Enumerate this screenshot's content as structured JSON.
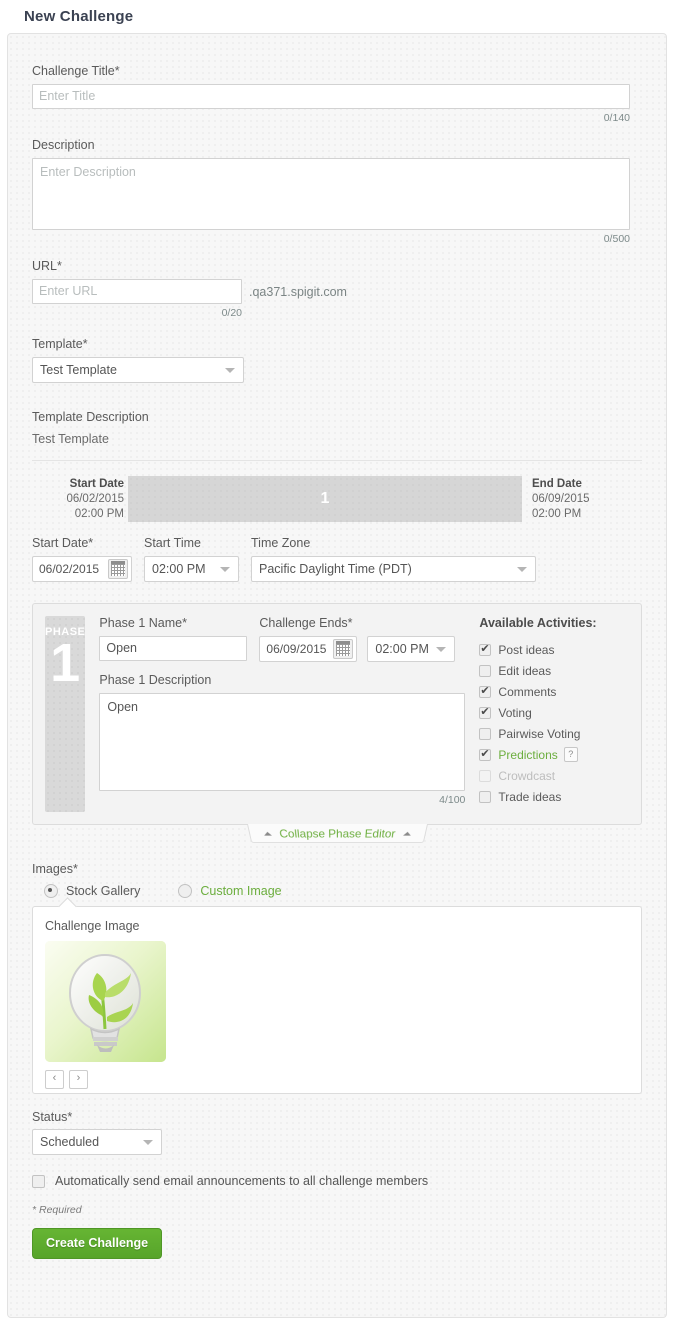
{
  "page": {
    "title": "New Challenge"
  },
  "form": {
    "challenge_title": {
      "label": "Challenge Title*",
      "value": "",
      "placeholder": "Enter Title",
      "counter": "0/140"
    },
    "description": {
      "label": "Description",
      "value": "",
      "placeholder": "Enter Description",
      "counter": "0/500"
    },
    "url": {
      "label": "URL*",
      "value": "",
      "placeholder": "Enter URL",
      "suffix": ".qa371.spigit.com",
      "counter": "0/20"
    },
    "template": {
      "label": "Template*",
      "value": "Test Template"
    },
    "template_description": {
      "label": "Template Description",
      "value": "Test Template"
    }
  },
  "timeline": {
    "start": {
      "label": "Start Date",
      "date": "06/02/2015",
      "time": "02:00 PM"
    },
    "end": {
      "label": "End Date",
      "date": "06/09/2015",
      "time": "02:00 PM"
    },
    "bar_label": "1"
  },
  "schedule": {
    "start_date": {
      "label": "Start Date*",
      "value": "06/02/2015"
    },
    "start_time": {
      "label": "Start Time",
      "value": "02:00 PM"
    },
    "time_zone": {
      "label": "Time Zone",
      "value": "Pacific Daylight Time (PDT)"
    }
  },
  "phase": {
    "badge_word": "PHASE",
    "badge_number": "1",
    "name": {
      "label": "Phase 1 Name*",
      "value": "Open"
    },
    "description": {
      "label": "Phase 1 Description",
      "value": "Open",
      "counter": "4/100"
    },
    "challenge_ends": {
      "label": "Challenge Ends*",
      "date": "06/09/2015",
      "time": "02:00 PM"
    },
    "activities_title": "Available Activities:",
    "activities": [
      {
        "label": "Post ideas",
        "checked": true,
        "disabled": false,
        "help": false
      },
      {
        "label": "Edit ideas",
        "checked": false,
        "disabled": false,
        "help": false
      },
      {
        "label": "Comments",
        "checked": true,
        "disabled": false,
        "help": false
      },
      {
        "label": "Voting",
        "checked": true,
        "disabled": false,
        "help": false
      },
      {
        "label": "Pairwise Voting",
        "checked": false,
        "disabled": false,
        "help": false
      },
      {
        "label": "Predictions",
        "checked": true,
        "disabled": false,
        "help": true,
        "help_text": "?"
      },
      {
        "label": "Crowdcast",
        "checked": false,
        "disabled": true,
        "help": false
      },
      {
        "label": "Trade ideas",
        "checked": false,
        "disabled": false,
        "help": false
      }
    ],
    "collapse_label": "Collapse Phase Editor"
  },
  "images": {
    "label": "Images*",
    "options": [
      {
        "label": "Stock Gallery",
        "selected": true
      },
      {
        "label": "Custom Image",
        "selected": false
      }
    ],
    "panel_caption": "Challenge Image",
    "prev_label": "‹",
    "next_label": "›"
  },
  "status": {
    "label": "Status*",
    "value": "Scheduled"
  },
  "email_option": {
    "label": "Automatically send email announcements to all challenge members",
    "checked": false
  },
  "required_note": "* Required",
  "submit": {
    "label": "Create Challenge"
  },
  "colors": {
    "accent_green": "#6cae3e",
    "button_green": "#57a42a",
    "panel_bg": "#f7f7f7",
    "timeline_bar": "#d6d6d6"
  }
}
